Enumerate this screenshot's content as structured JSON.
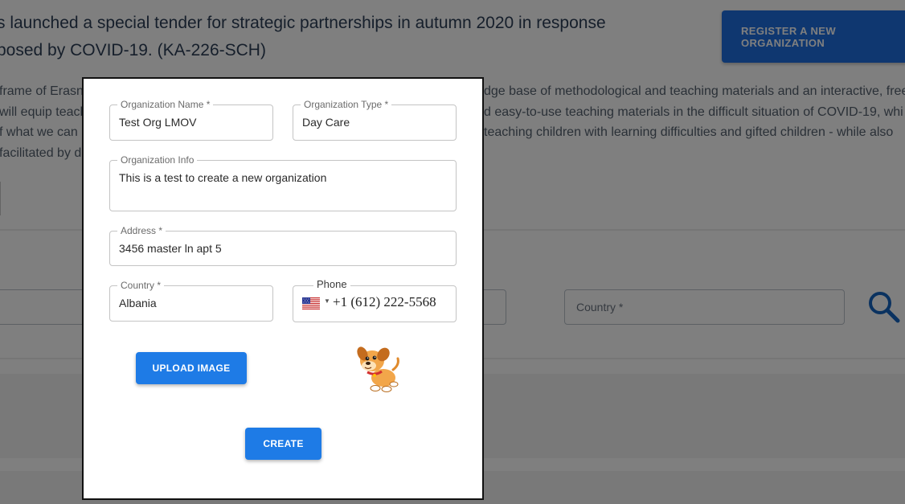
{
  "background": {
    "heading_lines": [
      "s launched a special tender for strategic partnerships in autumn 2020 in response",
      "posed by COVID-19. (KA-226-SCH)"
    ],
    "register_button": "REGISTER A NEW ORGANIZATION",
    "paragraph_left": [
      "frame of Erasn",
      "will equip teach",
      "f what we can",
      "facilitated by d"
    ],
    "paragraph_right": [
      "dge base of methodological and teaching materials and an interactive, free",
      "d easy-to-use teaching materials in the difficult situation of COVID-19, whi",
      " teaching children with learning difficulties and gifted children - while also",
      ""
    ],
    "search_country_placeholder": "Country *"
  },
  "modal": {
    "org_name": {
      "label": "Organization Name *",
      "value": "Test Org LMOV"
    },
    "org_type": {
      "label": "Organization Type *",
      "value": "Day Care"
    },
    "org_info": {
      "label": "Organization Info",
      "value": "This is a test to create a new organization"
    },
    "address": {
      "label": "Address *",
      "value": "3456 master ln apt 5"
    },
    "country": {
      "label": "Country *",
      "value": "Albania"
    },
    "phone": {
      "label": "Phone",
      "value": "+1 (612) 222-5568",
      "flag": "us-flag-icon"
    },
    "upload_button": "UPLOAD IMAGE",
    "create_button": "CREATE"
  },
  "colors": {
    "primary_button": "#1e7be6",
    "register_button": "#1e6fe0",
    "overlay": "rgba(0,0,0,0.5)"
  }
}
